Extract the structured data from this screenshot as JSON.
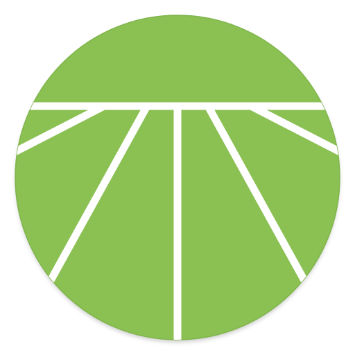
{
  "app_icon": {
    "icon": "sun-rays-field-icon",
    "colors": {
      "background": "#ffffff",
      "disc": "#8bc053",
      "disc_edge": "#7fb54a",
      "lines": "#ffffff",
      "shadow": "#9e9e9e"
    }
  }
}
